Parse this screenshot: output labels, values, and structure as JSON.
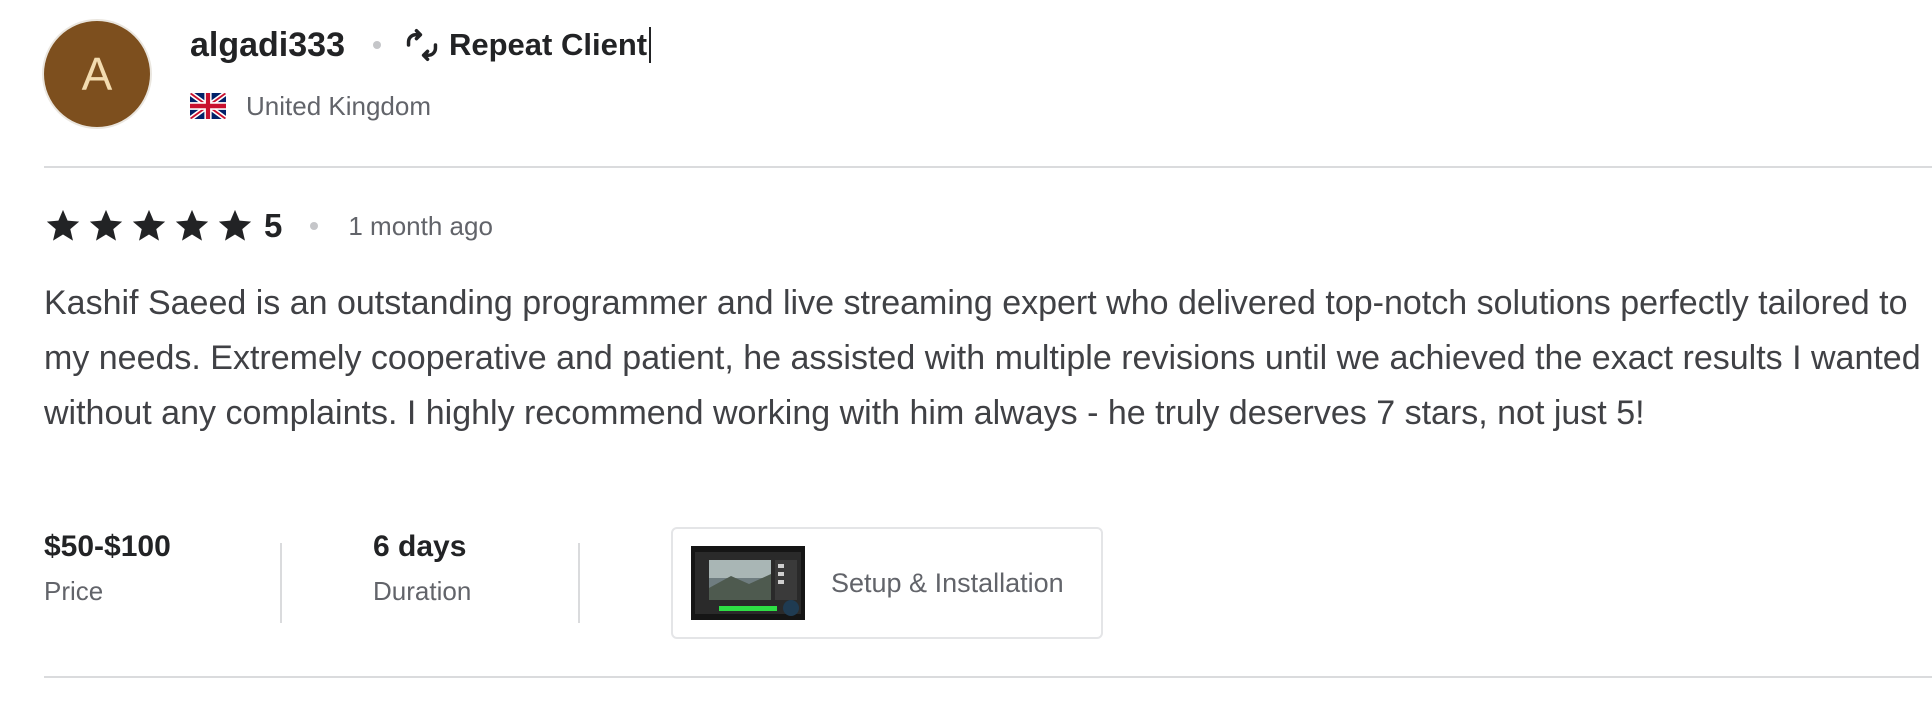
{
  "reviewer": {
    "avatar_letter": "A",
    "avatar_color": "#7d4f1e",
    "username": "algadi333",
    "repeat_icon": "repeat-arrows-icon",
    "repeat_label": "Repeat Client",
    "flag_icon": "uk-flag-icon",
    "country": "United Kingdom"
  },
  "rating": {
    "stars": 5,
    "max_stars": 5,
    "star_icon": "star-icon",
    "score": "5",
    "time_ago": "1 month ago"
  },
  "review": {
    "text": "Kashif Saeed is an outstanding programmer and live streaming expert who delivered top-notch solutions perfectly tailored to my needs. Extremely cooperative and patient, he assisted with multiple revisions until we achieved the exact results I wanted without any complaints. I highly recommend working with him always - he truly deserves 7 stars, not just 5!"
  },
  "meta": {
    "price_value": "$50-$100",
    "price_label": "Price",
    "duration_value": "6 days",
    "duration_label": "Duration"
  },
  "gig": {
    "thumbnail_icon": "gig-thumbnail-image",
    "title": "Setup & Installation"
  },
  "colors": {
    "text_primary": "#222325",
    "text_secondary": "#62646a",
    "divider": "#dadbdd"
  }
}
